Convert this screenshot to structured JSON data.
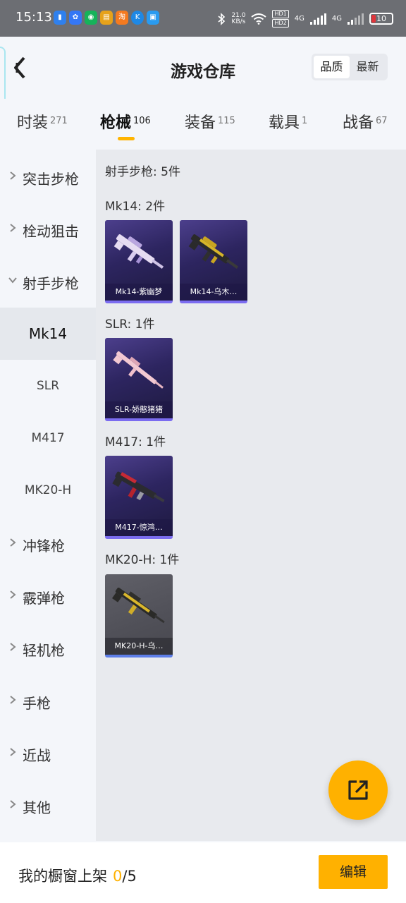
{
  "status_bar": {
    "time": "15:13",
    "net_speed_value": "21.0",
    "net_speed_unit": "KB/s",
    "hd_top": "HD1",
    "hd_bottom": "HD2",
    "net_1": "4G",
    "net_2": "4G",
    "battery": "10",
    "app_icons": [
      "app-icon",
      "baidu-paw-icon",
      "chat-icon",
      "news-icon",
      "taobao-icon",
      "k-icon",
      "phone-manager-icon"
    ]
  },
  "header": {
    "title": "游戏仓库",
    "sort_options": [
      "品质",
      "最新"
    ],
    "active_sort": "品质"
  },
  "tabs": [
    {
      "label": "时装",
      "count": "271"
    },
    {
      "label": "枪械",
      "count": "106"
    },
    {
      "label": "装备",
      "count": "115"
    },
    {
      "label": "载具",
      "count": "1"
    },
    {
      "label": "战备",
      "count": "67"
    }
  ],
  "active_tab": "枪械",
  "sidebar": {
    "items": [
      {
        "label": "突击步枪"
      },
      {
        "label": "栓动狙击"
      },
      {
        "label": "射手步枪",
        "expanded": true
      },
      {
        "label": "冲锋枪"
      },
      {
        "label": "霰弹枪"
      },
      {
        "label": "轻机枪"
      },
      {
        "label": "手枪"
      },
      {
        "label": "近战"
      },
      {
        "label": "其他"
      }
    ],
    "sub_items": [
      "Mk14",
      "SLR",
      "M417",
      "MK20-H"
    ],
    "active_sub": "Mk14"
  },
  "content": {
    "category_summary": "射手步枪: 5件",
    "groups": [
      {
        "title": "Mk14: 2件",
        "items": [
          {
            "name": "Mk14-紫幽梦"
          },
          {
            "name": "Mk14-乌木…"
          }
        ]
      },
      {
        "title": "SLR: 1件",
        "items": [
          {
            "name": "SLR-娇憨猪猪"
          }
        ]
      },
      {
        "title": "M417: 1件",
        "items": [
          {
            "name": "M417-惊鸿…"
          }
        ]
      },
      {
        "title": "MK20-H: 1件",
        "items": [
          {
            "name": "MK20-H-乌…"
          }
        ]
      }
    ]
  },
  "bottom_bar": {
    "label": "我的橱窗上架",
    "count_current": "0",
    "count_total": "/5",
    "edit_label": "编辑"
  },
  "colors": {
    "accent": "#ffb100",
    "card_purple": "#2d2560",
    "card_gray": "#55555c"
  }
}
